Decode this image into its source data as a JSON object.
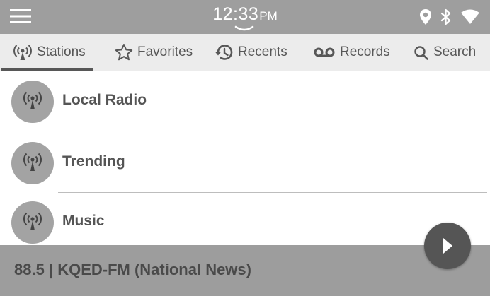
{
  "status_bar": {
    "time": "12:33",
    "ampm": "PM",
    "icons": [
      "menu-icon",
      "location-icon",
      "bluetooth-icon",
      "wifi-icon"
    ],
    "background_color": "#9e9e9e"
  },
  "tabs": [
    {
      "label": "Stations",
      "icon": "radio-tower-icon",
      "active": true
    },
    {
      "label": "Favorites",
      "icon": "star-outline-icon",
      "active": false
    },
    {
      "label": "Recents",
      "icon": "history-icon",
      "active": false
    },
    {
      "label": "Records",
      "icon": "voicemail-icon",
      "active": false
    },
    {
      "label": "Search",
      "icon": "search-icon",
      "active": false
    }
  ],
  "stations": [
    {
      "label": "Local Radio",
      "icon": "broadcast-antenna-icon"
    },
    {
      "label": "Trending",
      "icon": "broadcast-antenna-icon"
    },
    {
      "label": "Music",
      "icon": "broadcast-antenna-icon"
    }
  ],
  "now_playing": {
    "text": "88.5 | KQED-FM (National News)",
    "play_icon": "play-icon"
  }
}
